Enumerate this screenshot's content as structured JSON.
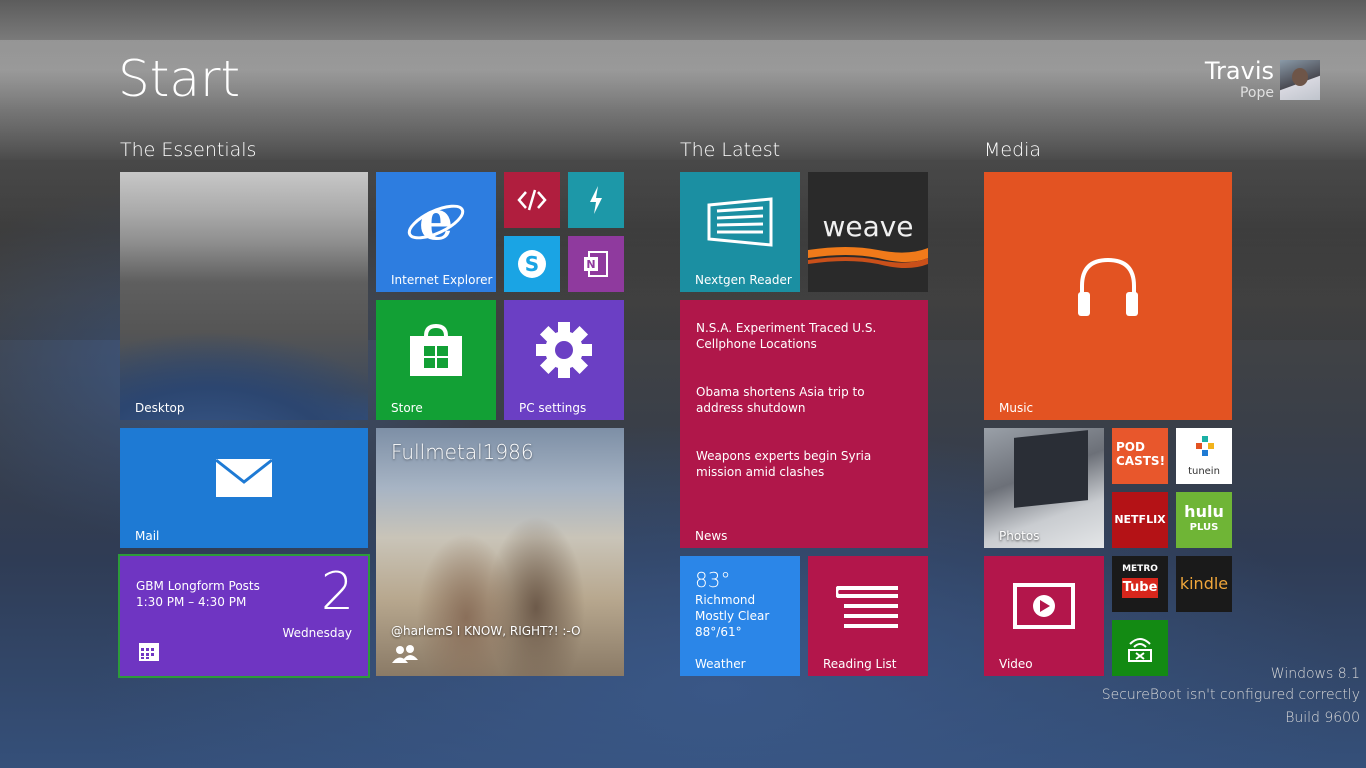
{
  "screen": {
    "title": "Start"
  },
  "user": {
    "first_name": "Travis",
    "last_name": "Pope"
  },
  "groups": [
    "The Essentials",
    "The Latest",
    "Media"
  ],
  "tiles": {
    "desktop": "Desktop",
    "internet_explorer": "Internet Explorer",
    "store": "Store",
    "pc_settings": "PC settings",
    "mail": "Mail",
    "people": {
      "name": "Fullmetal1986",
      "status": "@harlemS I KNOW, RIGHT?! :-O"
    },
    "calendar": {
      "event": "GBM Longform Posts",
      "time": "1:30 PM – 4:30 PM",
      "day_number": "2",
      "weekday": "Wednesday"
    },
    "nextgen_reader": "Nextgen Reader",
    "weave": "weave",
    "news": {
      "label": "News",
      "headlines": [
        "N.S.A. Experiment Traced U.S. Cellphone Locations",
        "Obama shortens Asia trip to address shutdown",
        "Weapons experts begin Syria mission amid clashes"
      ]
    },
    "weather": {
      "label": "Weather",
      "temp": "83°",
      "city": "Richmond",
      "condition": "Mostly Clear",
      "range": "88°/61°"
    },
    "reading_list": "Reading List",
    "music": "Music",
    "photos": "Photos",
    "video": "Video",
    "podcasts": "POD CASTS!",
    "tunein": "tunein",
    "netflix": "NETFLIX",
    "hulu": {
      "top": "hulu",
      "bottom": "PLUS"
    },
    "metro_tube": {
      "top": "METRO",
      "bottom": "Tube"
    },
    "kindle": "kindle"
  },
  "watermark": {
    "line1": "Windows 8.1",
    "line2": "SecureBoot isn't configured correctly",
    "line3": "Build 9600"
  },
  "colors": {
    "ie": "#2d7de0",
    "store": "#12a035",
    "pc_settings": "#6b3fc4",
    "mail": "#1e7ad4",
    "calendar": "#6f35c2",
    "news": "#b0174a",
    "weather": "#2b86e8",
    "music": "#e35322"
  }
}
